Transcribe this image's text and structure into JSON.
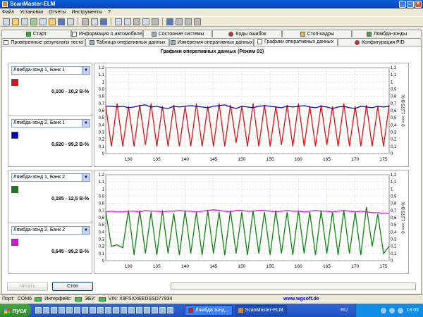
{
  "window": {
    "title": "ScanMaster-ELM"
  },
  "menu": [
    "Файл",
    "Установки",
    "Отчеты",
    "Инструменты",
    "?"
  ],
  "tabs_row1": [
    {
      "label": "Старт",
      "icon": "start-icon"
    },
    {
      "label": "Информация о автомобиле",
      "icon": "info-icon"
    },
    {
      "label": "Состояние системы",
      "icon": "system-icon"
    },
    {
      "label": "Коды ошибок",
      "icon": "error-codes-icon"
    },
    {
      "label": "Стоп-кадры",
      "icon": "freeze-frame-icon"
    },
    {
      "label": "Лямбда-зонды",
      "icon": "lambda-icon"
    }
  ],
  "tabs_row2": [
    {
      "label": "Проверенные результаты теста",
      "icon": "test-results-icon"
    },
    {
      "label": "Таблица оперативных данных",
      "icon": "table-icon"
    },
    {
      "label": "Измерения оперативных данных",
      "icon": "measure-icon"
    },
    {
      "label": "Графики оперативных данных",
      "icon": "graph-icon",
      "active": true
    },
    {
      "label": "Конфигурация PID",
      "icon": "pid-icon"
    }
  ],
  "graph_title": "Графики оперативных данных (Режим 01)",
  "sensors": [
    {
      "select": "Лямбда-зонд 1, Банк 1",
      "range": "0,100 - 10,2 В-%",
      "color": "#e01010"
    },
    {
      "select": "Лямбда-зонд 2, Банк 1",
      "range": "0,620 - 99,2 В-%",
      "color": "#0000c8"
    },
    {
      "select": "Лямбда-зонд 1, Банк 2",
      "range": "0,185 - 12,5 В-%",
      "color": "#108010"
    },
    {
      "select": "Лямбда-зонд 2, Банк 2",
      "range": "0,645 - 99,2 В-%",
      "color": "#e010e0"
    }
  ],
  "chart_data": [
    {
      "type": "line",
      "ylabel": "0 <<< 1,275 В-%",
      "ylim": [
        0,
        1.2
      ],
      "xlim": [
        126,
        176
      ],
      "x_ticks": [
        130,
        135,
        140,
        145,
        150,
        155,
        160,
        165,
        170,
        175
      ],
      "y_ticks": [
        "0",
        "0,1",
        "0,2",
        "0,3",
        "0,4",
        "0,5",
        "0,6",
        "0,7",
        "0,8",
        "0,9",
        "1",
        "1,1",
        "1,2"
      ],
      "grid": true,
      "series": [
        {
          "color": "#e01010",
          "values": [
            0.66,
            0.1,
            0.7,
            0.1,
            0.66,
            0.1,
            0.68,
            0.12,
            0.7,
            0.1,
            0.66,
            0.1,
            0.68,
            0.1,
            0.66,
            0.1,
            0.7,
            0.1,
            0.66,
            0.1,
            0.7,
            0.1,
            0.68,
            0.15,
            0.66,
            0.1,
            0.7,
            0.1,
            0.68,
            0.1,
            0.66,
            0.12,
            0.68,
            0.1,
            0.7,
            0.1,
            0.66,
            0.1,
            0.68,
            0.12,
            0.66,
            0.1,
            0.7,
            0.1,
            0.66,
            0.1,
            0.68,
            0.1,
            0.66,
            0.1,
            0.68
          ]
        },
        {
          "color": "#0000c8",
          "values": [
            0.66,
            0.66,
            0.65,
            0.66,
            0.64,
            0.65,
            0.67,
            0.68,
            0.65,
            0.66,
            0.64,
            0.63,
            0.66,
            0.65,
            0.66,
            0.67,
            0.66,
            0.65,
            0.64,
            0.66,
            0.67,
            0.68,
            0.65,
            0.63,
            0.66,
            0.65,
            0.64,
            0.66,
            0.67,
            0.66,
            0.65,
            0.64,
            0.66,
            0.65,
            0.66,
            0.67,
            0.65,
            0.64,
            0.66,
            0.65,
            0.63,
            0.65,
            0.66,
            0.64,
            0.63,
            0.66,
            0.65,
            0.64,
            0.66,
            0.65,
            0.66
          ]
        }
      ]
    },
    {
      "type": "line",
      "ylabel": "0 <<< 1,275 В-%",
      "ylim": [
        0,
        1.2
      ],
      "xlim": [
        126,
        176
      ],
      "x_ticks": [
        130,
        135,
        140,
        145,
        150,
        155,
        160,
        165,
        170,
        175
      ],
      "y_ticks": [
        "0",
        "0,1",
        "0,2",
        "0,3",
        "0,4",
        "0,5",
        "0,6",
        "0,7",
        "0,8",
        "0,9",
        "1",
        "1,1",
        "1,2"
      ],
      "grid": true,
      "series": [
        {
          "color": "#108010",
          "values": [
            0.68,
            0.2,
            0.22,
            0.18,
            0.7,
            0.08,
            0.7,
            0.1,
            0.68,
            0.08,
            0.7,
            0.1,
            0.66,
            0.08,
            0.7,
            0.1,
            0.68,
            0.08,
            0.7,
            0.1,
            0.68,
            0.08,
            0.7,
            0.1,
            0.68,
            0.08,
            0.7,
            0.1,
            0.68,
            0.08,
            0.7,
            0.1,
            0.68,
            0.08,
            0.7,
            0.1,
            0.68,
            0.08,
            0.7,
            0.1,
            0.68,
            0.08,
            0.7,
            0.1,
            0.68,
            0.08,
            0.75,
            0.2,
            0.65,
            0.1,
            0.2
          ]
        },
        {
          "color": "#e010e0",
          "values": [
            0.68,
            0.69,
            0.68,
            0.68,
            0.69,
            0.69,
            0.68,
            0.7,
            0.69,
            0.69,
            0.68,
            0.69,
            0.69,
            0.7,
            0.69,
            0.69,
            0.68,
            0.69,
            0.7,
            0.71,
            0.7,
            0.69,
            0.68,
            0.7,
            0.7,
            0.69,
            0.69,
            0.7,
            0.7,
            0.69,
            0.68,
            0.69,
            0.7,
            0.69,
            0.69,
            0.68,
            0.69,
            0.7,
            0.69,
            0.69,
            0.68,
            0.69,
            0.7,
            0.69,
            0.68,
            0.69,
            0.68,
            0.67,
            0.67,
            0.66,
            0.66
          ]
        }
      ]
    }
  ],
  "buttons": {
    "read": "Читать",
    "stop": "Стоп"
  },
  "status": {
    "port": "Порт:",
    "port_value": "COM6",
    "interface": "Интерфейс:",
    "ecu": "ЭБУ:",
    "vin": "VIN: X9FSXXEEDSSD77934",
    "url": "www.wgsoft.de"
  },
  "taskbar": {
    "start": "пуск",
    "tasks": [
      "Лямбда зонд...",
      "ScanMaster-ELM"
    ],
    "lang": "RU",
    "clock": "18:05"
  }
}
